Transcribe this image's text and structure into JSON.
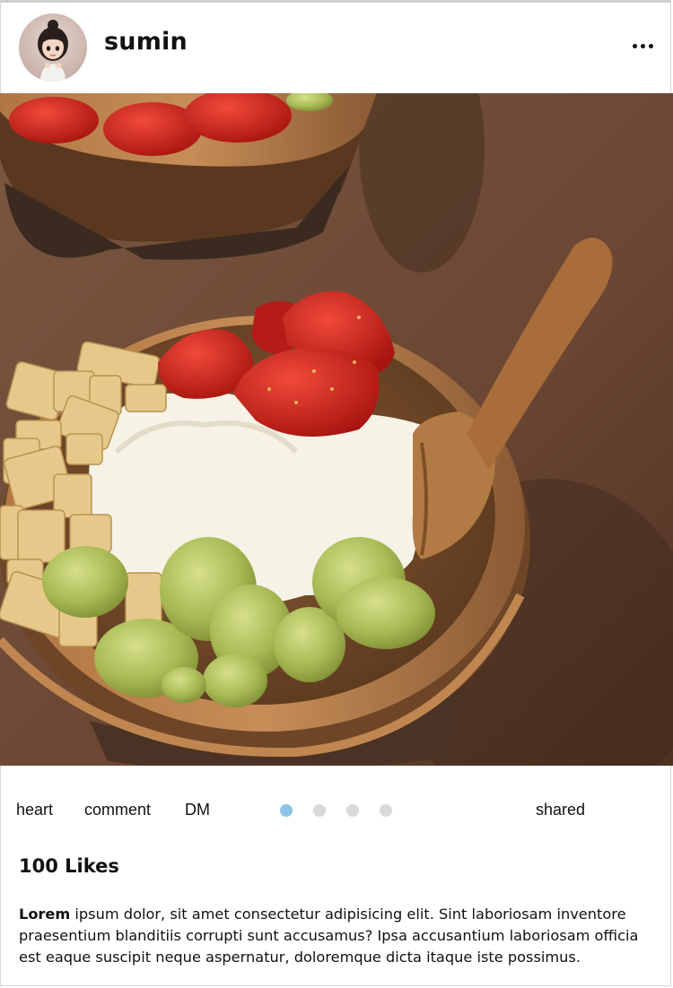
{
  "header": {
    "username": "sumin",
    "avatar_icon": "girl-avatar-icon",
    "more_icon": "more-horizontal-icon"
  },
  "photo": {
    "subject": "post-photo"
  },
  "actions": {
    "heart_label": "heart",
    "comment_label": "comment",
    "dm_label": "DM",
    "shared_label": "shared",
    "carousel": {
      "total": 4,
      "active_index": 0,
      "active_color": "#8ec3e6",
      "inactive_color": "#d9d9d9"
    }
  },
  "likes": {
    "text": "100 Likes"
  },
  "caption": {
    "author": "Lorem",
    "text": " ipsum dolor, sit amet consectetur adipisicing elit. Sint laboriosam inventore praesentium blanditiis corrupti sunt accusamus? Ipsa accusantium laboriosam officia est eaque suscipit neque aspernatur, doloremque dicta itaque iste possimus."
  }
}
